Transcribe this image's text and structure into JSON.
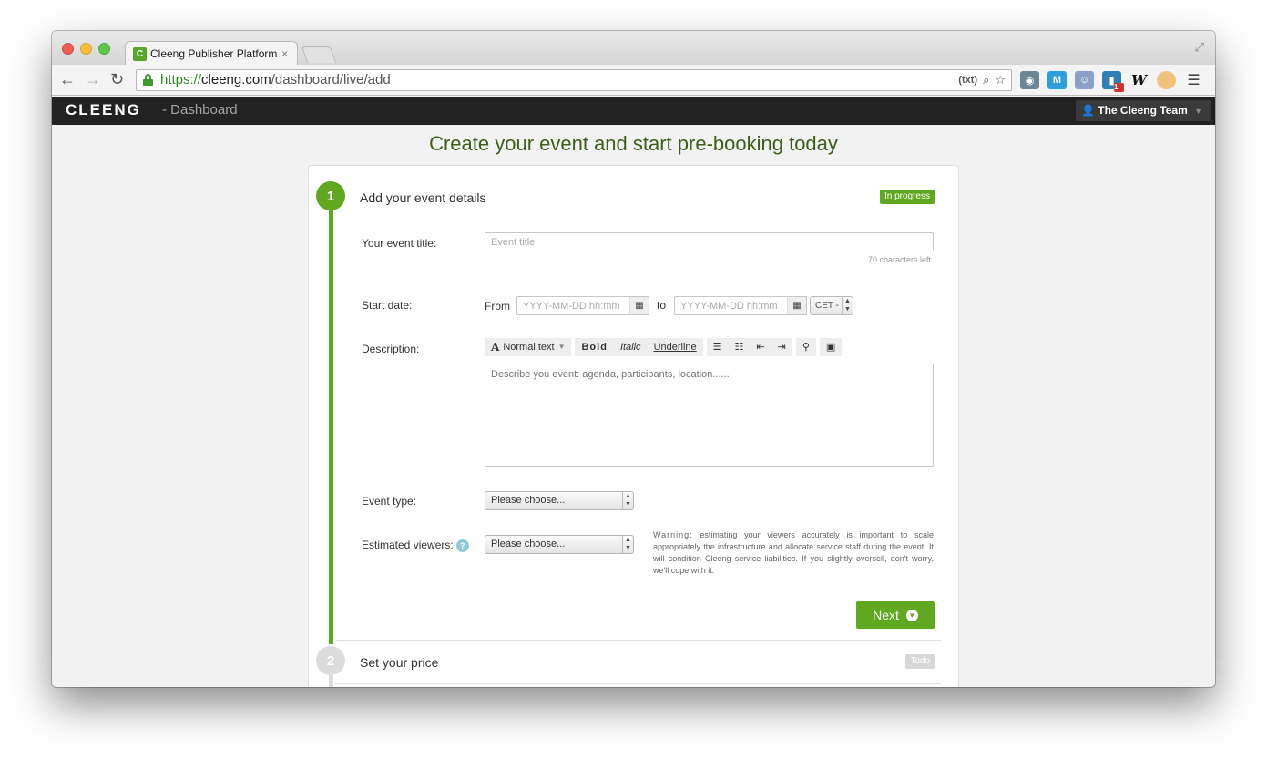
{
  "browser": {
    "tab_title": "Cleeng Publisher Platform",
    "tab_favicon": "C",
    "tab_close": "×",
    "url_scheme": "https://",
    "url_host": "cleeng.com",
    "url_path": "/dashboard/live/add",
    "omni_text_icon": "(txt)",
    "extensions": [
      "owl-icon",
      "m-icon",
      "person-card-icon",
      "trello-icon",
      "w-icon",
      "cat-icon",
      "menu-icon"
    ],
    "ext_m_label": "M",
    "ext_w_label": "W",
    "ext_badge": "1"
  },
  "appbar": {
    "brand": "CLEENG",
    "brand_sub": "- Dashboard",
    "user": "The Cleeng Team"
  },
  "page": {
    "title": "Create your event and start pre-booking today"
  },
  "steps": [
    {
      "number": "1",
      "title": "Add your event details",
      "status": "In progress"
    },
    {
      "number": "2",
      "title": "Set your price",
      "status": "Todo"
    }
  ],
  "form": {
    "event_title_label": "Your event title:",
    "event_title_placeholder": "Event title",
    "chars_left": "70 characters left",
    "start_date_label": "Start date:",
    "from_label": "From",
    "to_label": "to",
    "date_placeholder": "YYYY-MM-DD hh:mm",
    "timezone": "CET -",
    "description_label": "Description:",
    "description_placeholder": "Describe you event: agenda, participants, location......",
    "toolbar": {
      "text_style": "Normal text",
      "bold": "Bold",
      "italic": "Italic",
      "underline": "Underline"
    },
    "event_type_label": "Event type:",
    "event_type_value": "Please choose...",
    "viewers_label": "Estimated viewers:",
    "viewers_value": "Please choose...",
    "warning_label": "Warning:",
    "warning_text": " estimating your viewers accurately is important to scale appropriately the infrastructure and allocate service staff during the event. It will condition Cleeng service liabilities. If you slightly oversell, don't worry, we'll cope with it.",
    "next_label": "Next"
  },
  "colors": {
    "accent_green": "#5fa81f",
    "title_green": "#3e5e1a",
    "appbar_bg": "#222222"
  }
}
